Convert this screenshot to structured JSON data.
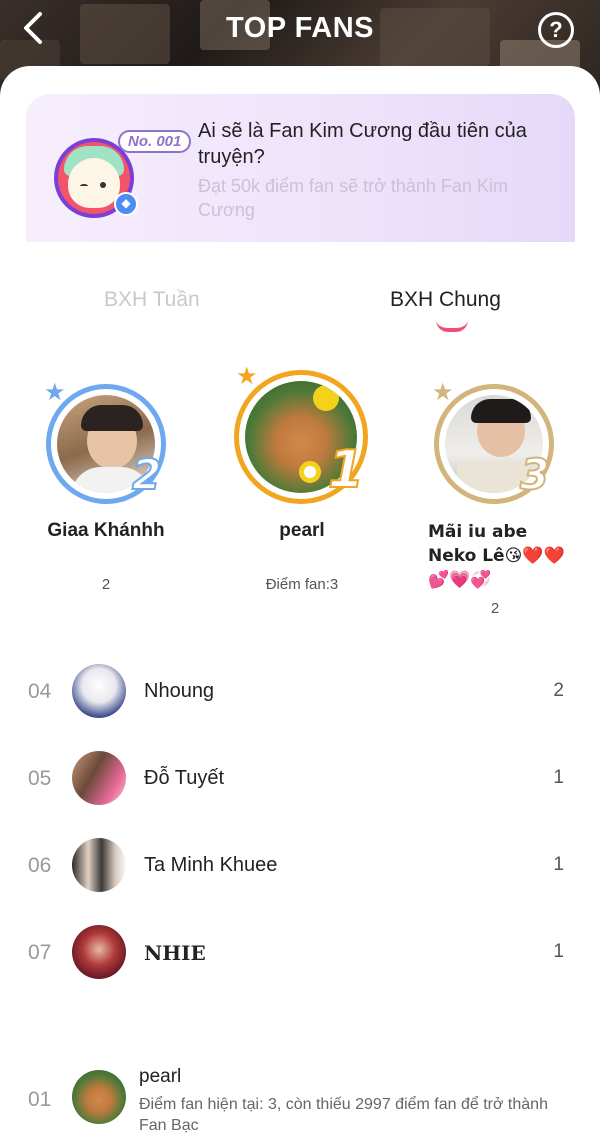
{
  "header": {
    "title": "TOP FANS",
    "back_icon": "chevron-left-icon",
    "help_label": "?"
  },
  "banner": {
    "badge": "No. 001",
    "title": "Ai sẽ là Fan Kim Cương đầu tiên của truyện?",
    "subtitle": "Đạt 50k điểm fan sẽ trở thành Fan Kim Cương",
    "badge_icon": "diamond-icon"
  },
  "tabs": [
    {
      "label": "BXH Tuần",
      "active": false
    },
    {
      "label": "BXH Chung",
      "active": true
    }
  ],
  "colors": {
    "accent": "#ee4f72",
    "silver": "#6fa8ef",
    "gold": "#f2a51e",
    "bronze": "#d2b47c"
  },
  "podium": {
    "first": {
      "rank": "1",
      "name": "pearl",
      "score": "Điểm fan:3"
    },
    "second": {
      "rank": "2",
      "name": "Giaa Khánhh",
      "score": "2"
    },
    "third": {
      "rank": "3",
      "name": "Mãi iu abe Neko Lê😘❤️❤️💕💗💞",
      "score": "2"
    }
  },
  "list": [
    {
      "rank": "04",
      "name": "Nhoung",
      "score": "2"
    },
    {
      "rank": "05",
      "name": "Đỗ Tuyết",
      "score": "1"
    },
    {
      "rank": "06",
      "name": "Ta Minh Khuee",
      "score": "1"
    },
    {
      "rank": "07",
      "name": "NHIE",
      "score": "1"
    }
  ],
  "me": {
    "rank": "01",
    "name": "pearl",
    "desc": "Điểm fan hiện tại: 3, còn thiếu 2997 điểm fan để trở thành Fan Bạc"
  }
}
